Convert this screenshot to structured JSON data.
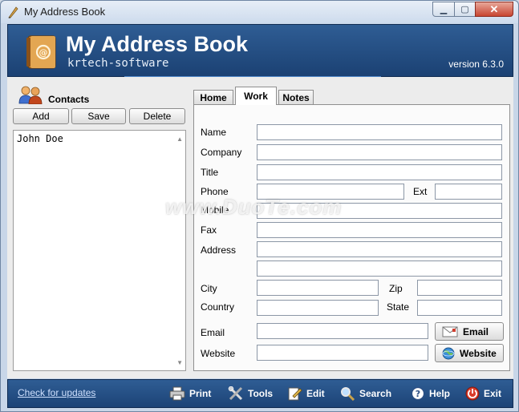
{
  "window": {
    "title": "My Address Book",
    "minimize_glyph": "▁",
    "maximize_glyph": "▢",
    "close_glyph": "✕"
  },
  "banner": {
    "title": "My Address Book",
    "subtitle": "krtech-software",
    "version": "version 6.3.0"
  },
  "contacts": {
    "heading": "Contacts",
    "add_label": "Add",
    "save_label": "Save",
    "delete_label": "Delete",
    "items": [
      "John  Doe"
    ]
  },
  "tabs": [
    {
      "label": "Home"
    },
    {
      "label": "Work",
      "selected": true
    },
    {
      "label": "Notes"
    }
  ],
  "form": {
    "name": {
      "label": "Name",
      "value": ""
    },
    "company": {
      "label": "Company",
      "value": ""
    },
    "title": {
      "label": "Title",
      "value": ""
    },
    "phone": {
      "label": "Phone",
      "value": ""
    },
    "ext": {
      "label": "Ext",
      "value": ""
    },
    "mobile": {
      "label": "Mobile",
      "value": ""
    },
    "fax": {
      "label": "Fax",
      "value": ""
    },
    "address": {
      "label": "Address",
      "line1": "",
      "line2": ""
    },
    "city": {
      "label": "City",
      "value": ""
    },
    "zip": {
      "label": "Zip",
      "value": ""
    },
    "country": {
      "label": "Country",
      "value": ""
    },
    "state": {
      "label": "State",
      "value": ""
    },
    "email": {
      "label": "Email",
      "value": "",
      "button_label": "Email"
    },
    "website": {
      "label": "Website",
      "value": "",
      "button_label": "Website"
    }
  },
  "footer": {
    "check_updates": "Check for updates",
    "print": "Print",
    "tools": "Tools",
    "edit": "Edit",
    "search": "Search",
    "help": "Help",
    "exit": "Exit"
  },
  "watermark": "www.DuoTe.com",
  "colors": {
    "banner": "#1b4173",
    "accent": "#2f5d94"
  }
}
